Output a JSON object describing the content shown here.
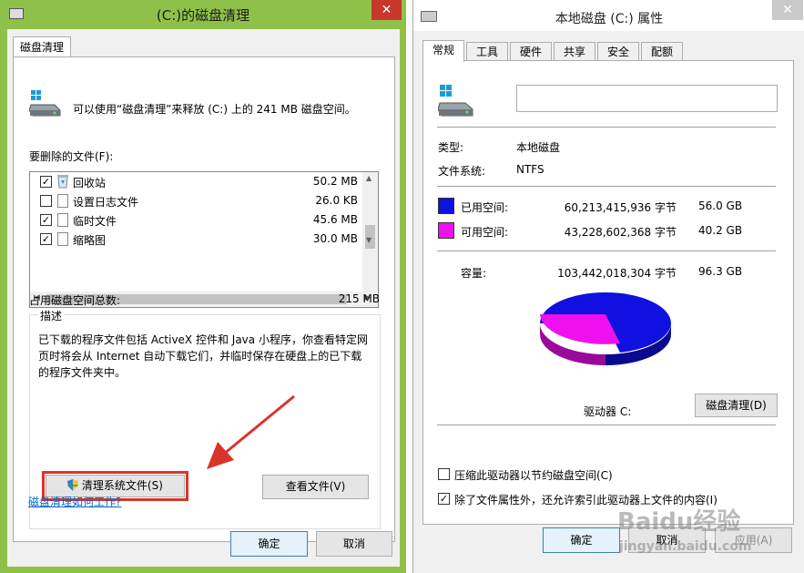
{
  "cleanup": {
    "title": "(C:)的磁盘清理",
    "close_glyph": "✕",
    "tab": "磁盘清理",
    "info": "可以使用“磁盘清理”来释放 (C:) 上的 241 MB 磁盘空间。",
    "files_label": "要删除的文件(F):",
    "files": [
      {
        "name": "回收站",
        "size": "50.2 MB",
        "checked": true,
        "icon": "recycle-bin-icon"
      },
      {
        "name": "设置日志文件",
        "size": "26.0 KB",
        "checked": false,
        "icon": "file-icon"
      },
      {
        "name": "临时文件",
        "size": "45.6 MB",
        "checked": true,
        "icon": "file-icon"
      },
      {
        "name": "缩略图",
        "size": "30.0 MB",
        "checked": true,
        "icon": "file-icon"
      }
    ],
    "total_label": "占用磁盘空间总数:",
    "total_value": "215 MB",
    "desc_title": "描述",
    "desc_text": "已下载的程序文件包括 ActiveX 控件和 Java 小程序，你查看特定网页时将会从 Internet 自动下载它们，并临时保存在硬盘上的已下载的程序文件夹中。",
    "clean_system_btn": "清理系统文件(S)",
    "view_files_btn": "查看文件(V)",
    "help_link": "磁盘清理如何工作?",
    "ok": "确定",
    "cancel": "取消",
    "highlight_color": "#d9342b",
    "window_frame_color": "#8fc14a"
  },
  "properties": {
    "title": "本地磁盘 (C:) 属性",
    "close_glyph": "✕",
    "tabs": [
      "常规",
      "工具",
      "硬件",
      "共享",
      "安全",
      "配额"
    ],
    "name_value": "",
    "type_label": "类型:",
    "type_value": "本地磁盘",
    "fs_label": "文件系统:",
    "fs_value": "NTFS",
    "used_label": "已用空间:",
    "used_bytes": "60,213,415,936 字节",
    "used_gb": "56.0 GB",
    "free_label": "可用空间:",
    "free_bytes": "43,228,602,368 字节",
    "free_gb": "40.2 GB",
    "cap_label": "容量:",
    "cap_bytes": "103,442,018,304 字节",
    "cap_gb": "96.3 GB",
    "used_color": "#1010e0",
    "free_color": "#ee10ee",
    "drive_label": "驱动器 C:",
    "cleanup_btn": "磁盘清理(D)",
    "compress_label": "压缩此驱动器以节约磁盘空间(C)",
    "compress_checked": false,
    "index_label": "除了文件属性外，还允许索引此驱动器上文件的内容(I)",
    "index_checked": true,
    "ok": "确定",
    "cancel": "取消",
    "apply": "应用(A)"
  },
  "watermark": {
    "line1": "Baidu经验",
    "line2": "jingyan.baidu.com"
  }
}
